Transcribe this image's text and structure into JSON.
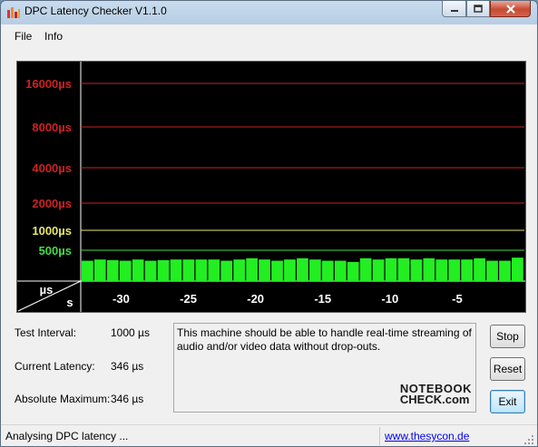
{
  "window": {
    "title": "DPC Latency Checker V1.1.0"
  },
  "menu": [
    "File",
    "Info"
  ],
  "chart_data": {
    "type": "bar",
    "y_labels": [
      {
        "text": "16000µs",
        "color": "#cc2222"
      },
      {
        "text": "8000µs",
        "color": "#cc2222"
      },
      {
        "text": "4000µs",
        "color": "#cc2222"
      },
      {
        "text": "2000µs",
        "color": "#cc2222"
      },
      {
        "text": "1000µs",
        "color": "#e6e66a"
      },
      {
        "text": "500µs",
        "color": "#44dd44"
      }
    ],
    "axis_corner": {
      "top": "µs",
      "bottom": "s"
    },
    "x_ticks": [
      "-30",
      "-25",
      "-20",
      "-15",
      "-10",
      "-5"
    ],
    "x_range": [
      -33,
      0
    ],
    "values_us": [
      330,
      350,
      340,
      330,
      350,
      330,
      340,
      350,
      350,
      350,
      350,
      330,
      350,
      370,
      350,
      330,
      350,
      370,
      350,
      330,
      330,
      310,
      370,
      350,
      370,
      370,
      350,
      370,
      350,
      350,
      350,
      370,
      330,
      330,
      380
    ],
    "bar_color": "#22ee22"
  },
  "info": {
    "test_interval_label": "Test Interval:",
    "test_interval_value": "1000 µs",
    "current_latency_label": "Current Latency:",
    "current_latency_value": "346 µs",
    "absolute_max_label": "Absolute Maximum:",
    "absolute_max_value": "346 µs"
  },
  "message": "This machine should be able to handle real-time streaming of audio and/or video data without drop-outs.",
  "logo": {
    "top": "NOTEBOOK",
    "bottom": "CHECK.com"
  },
  "buttons": {
    "stop": "Stop",
    "reset": "Reset",
    "exit": "Exit"
  },
  "status": {
    "text": "Analysing DPC latency ...",
    "link": "www.thesycon.de"
  }
}
